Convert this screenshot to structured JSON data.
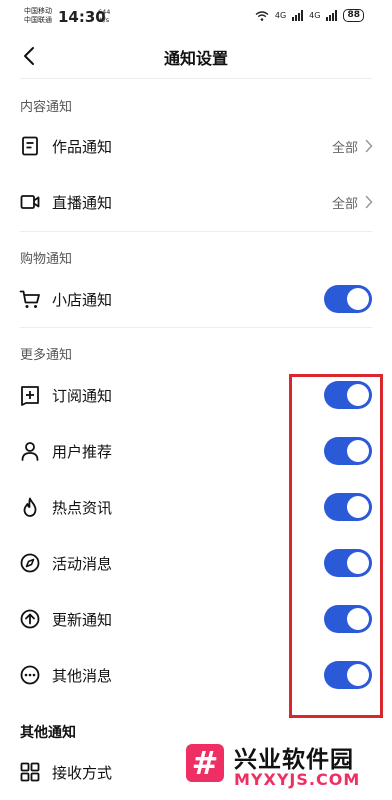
{
  "status_bar": {
    "carrier_1": "中国移动",
    "carrier_2": "中国联通",
    "time": "14:30",
    "speed_value": "644",
    "speed_unit": "K/s",
    "net_1": "4G",
    "net_2": "4G",
    "battery": "88"
  },
  "nav": {
    "title": "通知设置"
  },
  "sections": {
    "content": "内容通知",
    "shopping": "购物通知",
    "more": "更多通知",
    "other": "其他通知"
  },
  "content_rows": [
    {
      "label": "作品通知",
      "value": "全部",
      "icon": "document-icon"
    },
    {
      "label": "直播通知",
      "value": "全部",
      "icon": "video-camera-icon"
    }
  ],
  "shopping_rows": [
    {
      "label": "小店通知",
      "on": true,
      "icon": "cart-icon"
    }
  ],
  "more_rows": [
    {
      "label": "订阅通知",
      "on": true,
      "icon": "subscribe-plus-icon"
    },
    {
      "label": "用户推荐",
      "on": true,
      "icon": "user-icon"
    },
    {
      "label": "热点资讯",
      "on": true,
      "icon": "flame-icon"
    },
    {
      "label": "活动消息",
      "on": true,
      "icon": "compass-icon"
    },
    {
      "label": "更新通知",
      "on": true,
      "icon": "arrow-up-circle-icon"
    },
    {
      "label": "其他消息",
      "on": true,
      "icon": "more-dots-circle-icon"
    }
  ],
  "other_rows": [
    {
      "label": "接收方式",
      "icon": "grid-icon"
    }
  ],
  "watermark": {
    "logo_glyph": "#",
    "title": "兴业软件园",
    "url": "MYXYJS.COM"
  },
  "colors": {
    "toggle_on": "#2b5ad8",
    "highlight_border": "#d8272d",
    "watermark_accent": "#ef2f63"
  }
}
